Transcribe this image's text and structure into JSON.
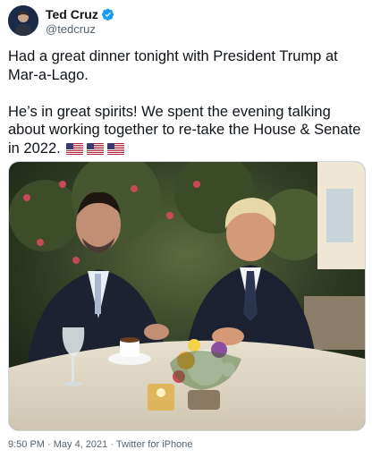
{
  "author": {
    "name": "Ted Cruz",
    "handle": "@tedcruz",
    "verified": true,
    "avatar_icon": "profile-photo"
  },
  "tweet": {
    "line1": "Had a great dinner tonight with President Trump at Mar-a-Lago.",
    "line2": "He’s in great spirits! We spent the evening talking about working together to re-take the House & Senate in 2022.",
    "flags": [
      "us-flag-icon",
      "us-flag-icon",
      "us-flag-icon"
    ]
  },
  "media": {
    "type": "photo"
  },
  "meta": {
    "footer": "9:50 PM · May 4, 2021 · Twitter for iPhone"
  },
  "colors": {
    "text": "#0f1419",
    "secondary": "#536471",
    "verified_blue": "#1d9bf0"
  }
}
